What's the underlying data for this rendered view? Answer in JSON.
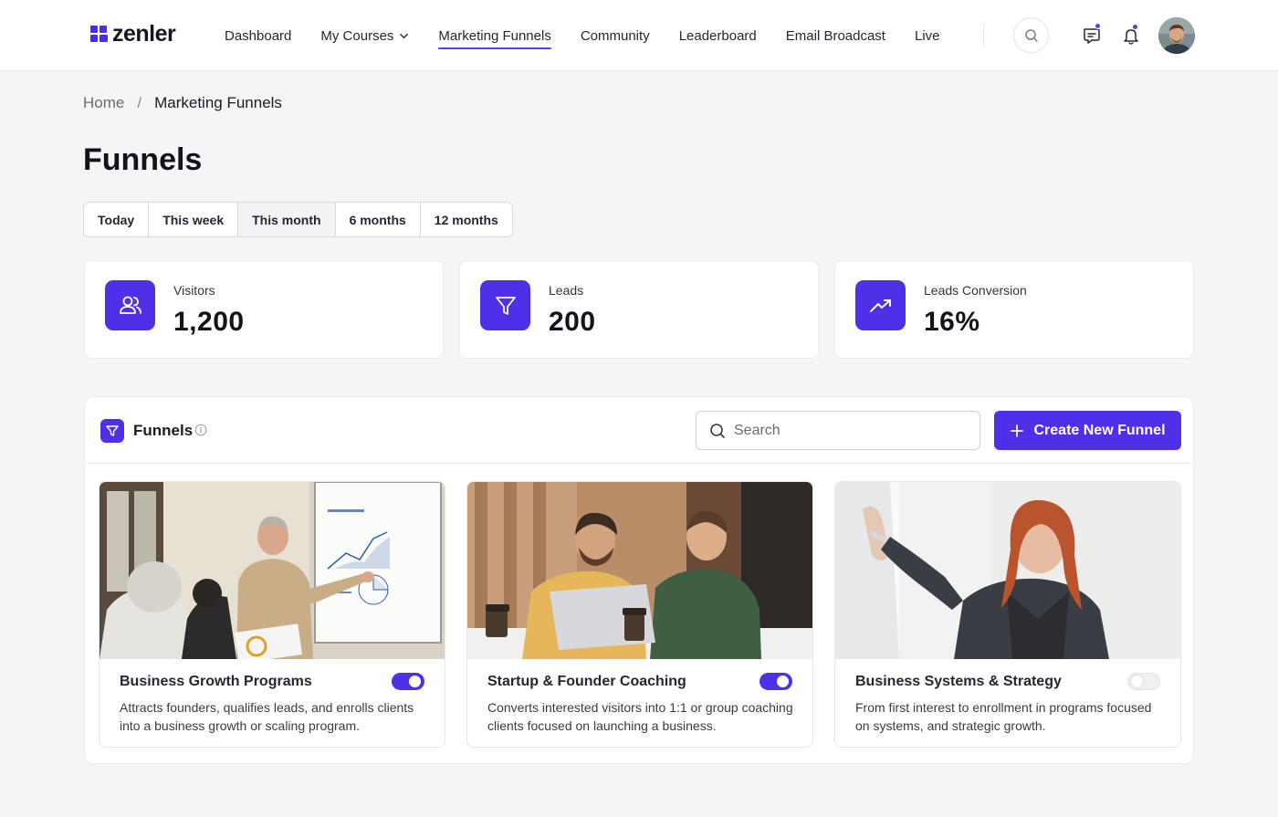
{
  "app": {
    "logo_text": "zenler"
  },
  "nav": {
    "items": [
      {
        "label": "Dashboard"
      },
      {
        "label": "My Courses"
      },
      {
        "label": "Marketing Funnels"
      },
      {
        "label": "Community"
      },
      {
        "label": "Leaderboard"
      },
      {
        "label": "Email Broadcast"
      },
      {
        "label": "Live"
      }
    ],
    "active": "Marketing Funnels"
  },
  "breadcrumb": {
    "home": "Home",
    "separator": "/",
    "current": "Marketing Funnels"
  },
  "page": {
    "title": "Funnels"
  },
  "periods": {
    "options": [
      "Today",
      "This week",
      "This month",
      "6 months",
      "12 months"
    ],
    "selected": "This month"
  },
  "stats": [
    {
      "label": "Visitors",
      "value": "1,200",
      "icon": "users-icon"
    },
    {
      "label": "Leads",
      "value": "200",
      "icon": "filter-icon"
    },
    {
      "label": "Leads Conversion",
      "value": "16%",
      "icon": "trending-up-icon"
    }
  ],
  "funnels_panel": {
    "title": "Funnels",
    "search_placeholder": "Search",
    "create_label": "Create New Funnel"
  },
  "funnels": [
    {
      "title": "Business Growth Programs",
      "description": "Attracts founders, qualifies leads, and enrolls clients into a business growth or scaling program.",
      "enabled": true
    },
    {
      "title": "Startup & Founder Coaching",
      "description": "Converts interested visitors into 1:1 or group coaching clients focused on launching a business.",
      "enabled": true
    },
    {
      "title": "Business Systems & Strategy",
      "description": "From first interest to enrollment in programs focused on systems, and strategic growth.",
      "enabled": false
    }
  ],
  "colors": {
    "accent": "#4f2fe8",
    "background": "#f5f5f6"
  }
}
